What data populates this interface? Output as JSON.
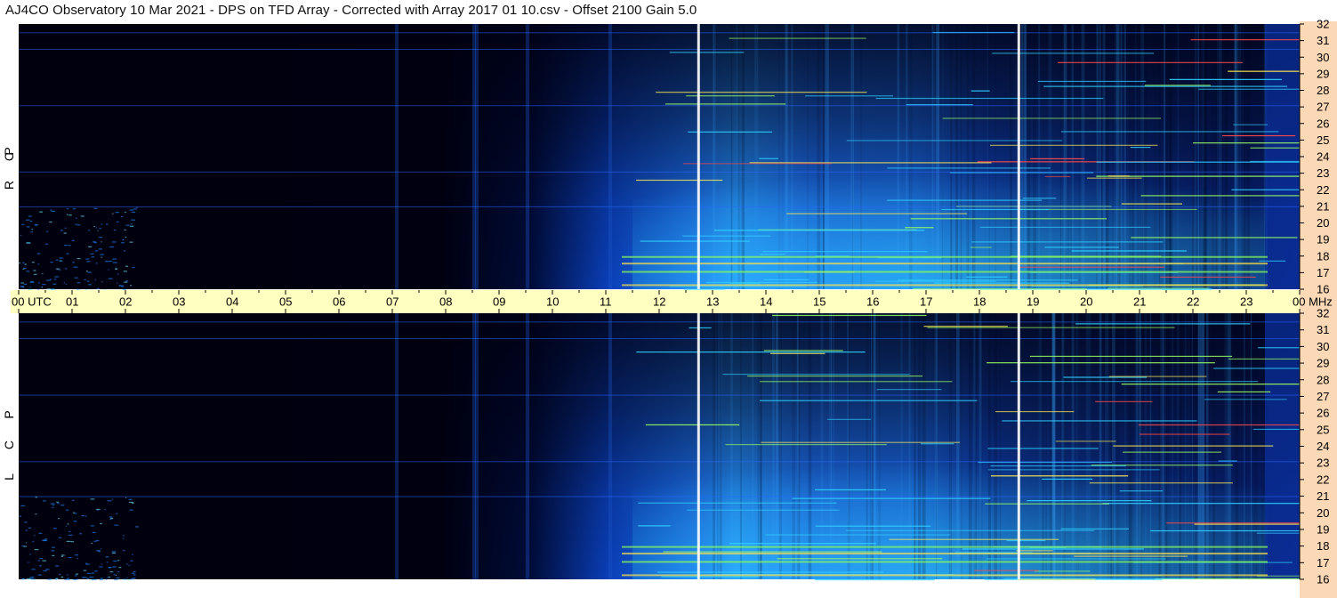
{
  "header": {
    "title": "AJ4CO Observatory  10 Mar 2021  -  DPS on TFD Array  -  Corrected with Array 2017 01 10.csv  -  Offset 2100  Gain 5.0"
  },
  "panels": {
    "top": {
      "label_letters": [
        "P",
        "C",
        "R"
      ]
    },
    "bottom": {
      "label_letters": [
        "P",
        "C",
        "L"
      ]
    }
  },
  "colors": {
    "background_dark": "#000014",
    "accent_blue": "#1a6cff",
    "hot_green": "#bfff3a",
    "time_bar": "#ffffc0",
    "freq_strip": "#fcd9b6"
  },
  "chart_data": {
    "type": "heatmap",
    "title": "AJ4CO Observatory  10 Mar 2021  -  DPS on TFD Array  -  Corrected with Array 2017 01 10.csv  -  Offset 2100  Gain 5.0",
    "x_tick_labels": [
      "00 UTC",
      "01",
      "02",
      "03",
      "04",
      "05",
      "06",
      "07",
      "08",
      "09",
      "10",
      "11",
      "12",
      "13",
      "14",
      "15",
      "16",
      "17",
      "18",
      "19",
      "20",
      "21",
      "22",
      "23",
      "00 MHz"
    ],
    "x_ticks_hours": [
      0,
      1,
      2,
      3,
      4,
      5,
      6,
      7,
      8,
      9,
      10,
      11,
      12,
      13,
      14,
      15,
      16,
      17,
      18,
      19,
      20,
      21,
      22,
      23,
      24
    ],
    "xlim": [
      0,
      24
    ],
    "y_unit": "MHz",
    "y_tick_labels": [
      "32",
      "31",
      "30",
      "29",
      "28",
      "27",
      "26",
      "25",
      "24",
      "23",
      "22",
      "21",
      "20",
      "19",
      "18",
      "17",
      "16"
    ],
    "y_ticks_mhz": [
      32,
      31,
      30,
      29,
      28,
      27,
      26,
      25,
      24,
      23,
      22,
      21,
      20,
      19,
      18,
      17,
      16
    ],
    "ylim": [
      16,
      32
    ],
    "series": [
      {
        "name": "R C P"
      },
      {
        "name": "L C P"
      }
    ],
    "calibration_marks_hours": [
      12.73,
      18.73
    ],
    "daylight_brightening_hours": [
      8.5,
      23.3
    ],
    "colormap": [
      "#000010",
      "#001a66",
      "#0a4fd8",
      "#1f8cff",
      "#2fd1ff",
      "#9bff62",
      "#fff055",
      "#ff4a4a"
    ]
  }
}
